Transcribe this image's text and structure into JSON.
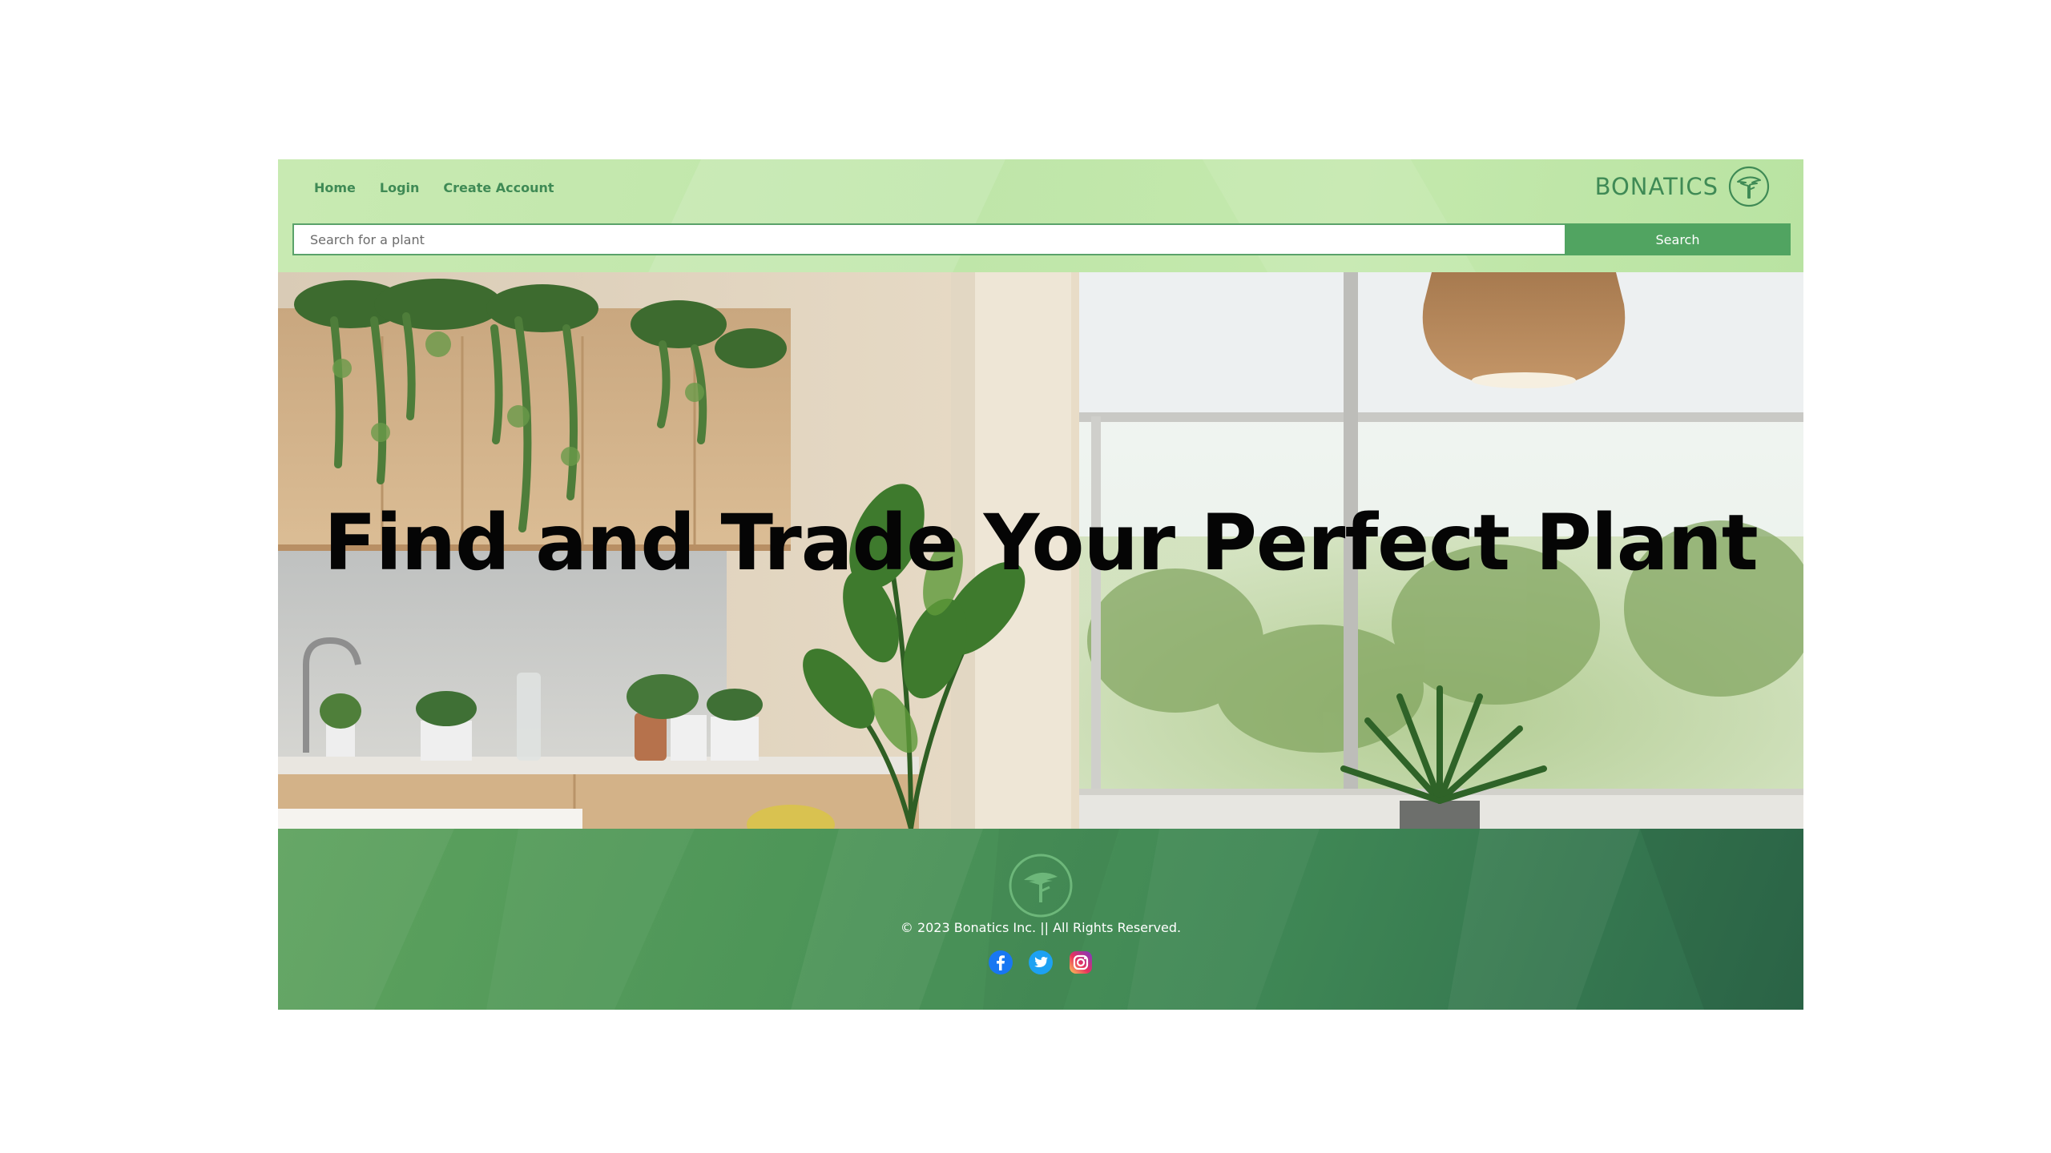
{
  "nav": {
    "home": "Home",
    "login": "Login",
    "create_account": "Create Account"
  },
  "brand": {
    "name": "BONATICS",
    "logo_icon": "tree-icon"
  },
  "search": {
    "placeholder": "Search for a plant",
    "value": "",
    "button_label": "Search"
  },
  "hero": {
    "title": "Find and Trade Your Perfect Plant"
  },
  "footer": {
    "logo_icon": "tree-icon",
    "copyright": "© 2023 Bonatics Inc. || All Rights Reserved.",
    "socials": [
      {
        "name": "facebook-icon"
      },
      {
        "name": "twitter-icon"
      },
      {
        "name": "instagram-icon"
      }
    ]
  },
  "colors": {
    "header_bg": "#c2e7ab",
    "accent_green": "#51a461",
    "nav_text": "#3f8a55",
    "footer_bg": "#3f8755"
  }
}
